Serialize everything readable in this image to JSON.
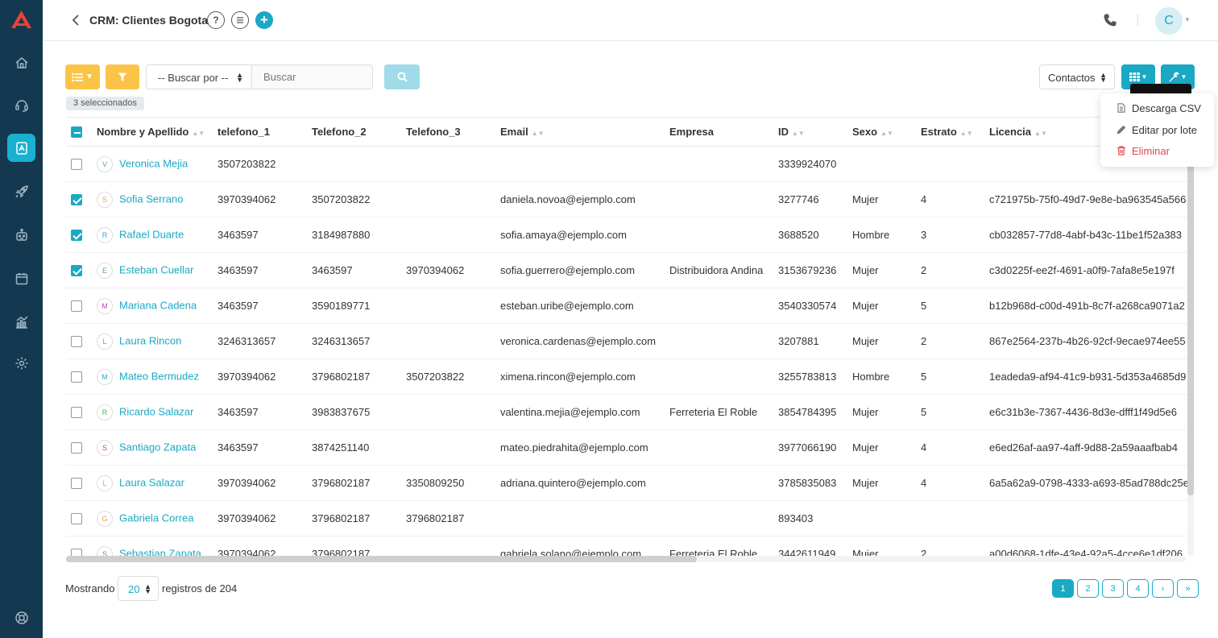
{
  "header": {
    "title": "CRM: Clientes Bogota",
    "help_label": "?",
    "user_initial": "C"
  },
  "toolbar": {
    "search_select": "-- Buscar por --",
    "search_placeholder": "Buscar",
    "selected_badge": "3 seleccionados",
    "view_select": "Contactos"
  },
  "dropdown": {
    "items": [
      "Descarga CSV",
      "Editar por lote",
      "Eliminar"
    ]
  },
  "table": {
    "headers": [
      "Nombre y Apellido",
      "telefono_1",
      "Telefono_2",
      "Telefono_3",
      "Email",
      "Empresa",
      "ID",
      "Sexo",
      "Estrato",
      "Licencia"
    ],
    "rows": [
      {
        "checked": false,
        "initial": "V",
        "color": "#5fb05f",
        "name": "Veronica Mejia",
        "t1": "3507203822",
        "t2": "",
        "t3": "",
        "email": "",
        "empresa": "",
        "id": "3339924070",
        "sexo": "",
        "estrato": "",
        "licencia": ""
      },
      {
        "checked": true,
        "initial": "S",
        "color": "#e8a040",
        "name": "Sofia Serrano",
        "t1": "3970394062",
        "t2": "3507203822",
        "t3": "",
        "email": "daniela.novoa@ejemplo.com",
        "empresa": "",
        "id": "3277746",
        "sexo": "Mujer",
        "estrato": "4",
        "licencia": "c721975b-75f0-49d7-9e8e-ba963545a566"
      },
      {
        "checked": true,
        "initial": "R",
        "color": "#3aa8d0",
        "name": "Rafael Duarte",
        "t1": "3463597",
        "t2": "3184987880",
        "t3": "",
        "email": "sofia.amaya@ejemplo.com",
        "empresa": "",
        "id": "3688520",
        "sexo": "Hombre",
        "estrato": "3",
        "licencia": "cb032857-77d8-4abf-b43c-11be1f52a383"
      },
      {
        "checked": true,
        "initial": "E",
        "color": "#5fb05f",
        "name": "Esteban Cuellar",
        "t1": "3463597",
        "t2": "3463597",
        "t3": "3970394062",
        "email": "sofia.guerrero@ejemplo.com",
        "empresa": "Distribuidora Andina",
        "id": "3153679236",
        "sexo": "Mujer",
        "estrato": "2",
        "licencia": "c3d0225f-ee2f-4691-a0f9-7afa8e5e197f"
      },
      {
        "checked": false,
        "initial": "M",
        "color": "#c050c0",
        "name": "Mariana Cadena",
        "t1": "3463597",
        "t2": "3590189771",
        "t3": "",
        "email": "esteban.uribe@ejemplo.com",
        "empresa": "",
        "id": "3540330574",
        "sexo": "Mujer",
        "estrato": "5",
        "licencia": "b12b968d-c00d-491b-8c7f-a268ca9071a2"
      },
      {
        "checked": false,
        "initial": "L",
        "color": "#3aa8d0",
        "name": "Laura Rincon",
        "t1": "3246313657",
        "t2": "3246313657",
        "t3": "",
        "email": "veronica.cardenas@ejemplo.com",
        "empresa": "",
        "id": "3207881",
        "sexo": "Mujer",
        "estrato": "2",
        "licencia": "867e2564-237b-4b26-92cf-9ecae974ee55"
      },
      {
        "checked": false,
        "initial": "M",
        "color": "#3aa8d0",
        "name": "Mateo Bermudez",
        "t1": "3970394062",
        "t2": "3796802187",
        "t3": "3507203822",
        "email": "ximena.rincon@ejemplo.com",
        "empresa": "",
        "id": "3255783813",
        "sexo": "Hombre",
        "estrato": "5",
        "licencia": "1eadeda9-af94-41c9-b931-5d353a4685d9"
      },
      {
        "checked": false,
        "initial": "R",
        "color": "#5fb05f",
        "name": "Ricardo Salazar",
        "t1": "3463597",
        "t2": "3983837675",
        "t3": "",
        "email": "valentina.mejia@ejemplo.com",
        "empresa": "Ferreteria El Roble",
        "id": "3854784395",
        "sexo": "Mujer",
        "estrato": "5",
        "licencia": "e6c31b3e-7367-4436-8d3e-dfff1f49d5e6"
      },
      {
        "checked": false,
        "initial": "S",
        "color": "#e04848",
        "name": "Santiago Zapata",
        "t1": "3463597",
        "t2": "3874251140",
        "t3": "",
        "email": "mateo.piedrahita@ejemplo.com",
        "empresa": "",
        "id": "3977066190",
        "sexo": "Mujer",
        "estrato": "4",
        "licencia": "e6ed26af-aa97-4aff-9d88-2a59aaafbab4"
      },
      {
        "checked": false,
        "initial": "L",
        "color": "#e8a040",
        "name": "Laura Salazar",
        "t1": "3970394062",
        "t2": "3796802187",
        "t3": "3350809250",
        "email": "adriana.quintero@ejemplo.com",
        "empresa": "",
        "id": "3785835083",
        "sexo": "Mujer",
        "estrato": "4",
        "licencia": "6a5a62a9-0798-4333-a693-85ad788dc25e"
      },
      {
        "checked": false,
        "initial": "G",
        "color": "#e8a040",
        "name": "Gabriela Correa",
        "t1": "3970394062",
        "t2": "3796802187",
        "t3": "3796802187",
        "email": "",
        "empresa": "",
        "id": "893403",
        "sexo": "",
        "estrato": "",
        "licencia": ""
      },
      {
        "checked": false,
        "initial": "S",
        "color": "#c050c0",
        "name": "Sebastian Zapata",
        "t1": "3970394062",
        "t2": "3796802187",
        "t3": "",
        "email": "gabriela.solano@ejemplo.com",
        "empresa": "Ferreteria El Roble",
        "id": "3442611949",
        "sexo": "Mujer",
        "estrato": "2",
        "licencia": "a00d6068-1dfe-43e4-92a5-4cce6e1df206"
      }
    ]
  },
  "footer": {
    "showing_label": "Mostrando",
    "per_page": "20",
    "records_label": "registros de 204",
    "pages": [
      "1",
      "2",
      "3",
      "4",
      "›",
      "»"
    ]
  },
  "colors": {
    "accent": "#1aa9c4",
    "sidebar": "#14384f",
    "warning": "#fbc449",
    "danger": "#e04848"
  }
}
